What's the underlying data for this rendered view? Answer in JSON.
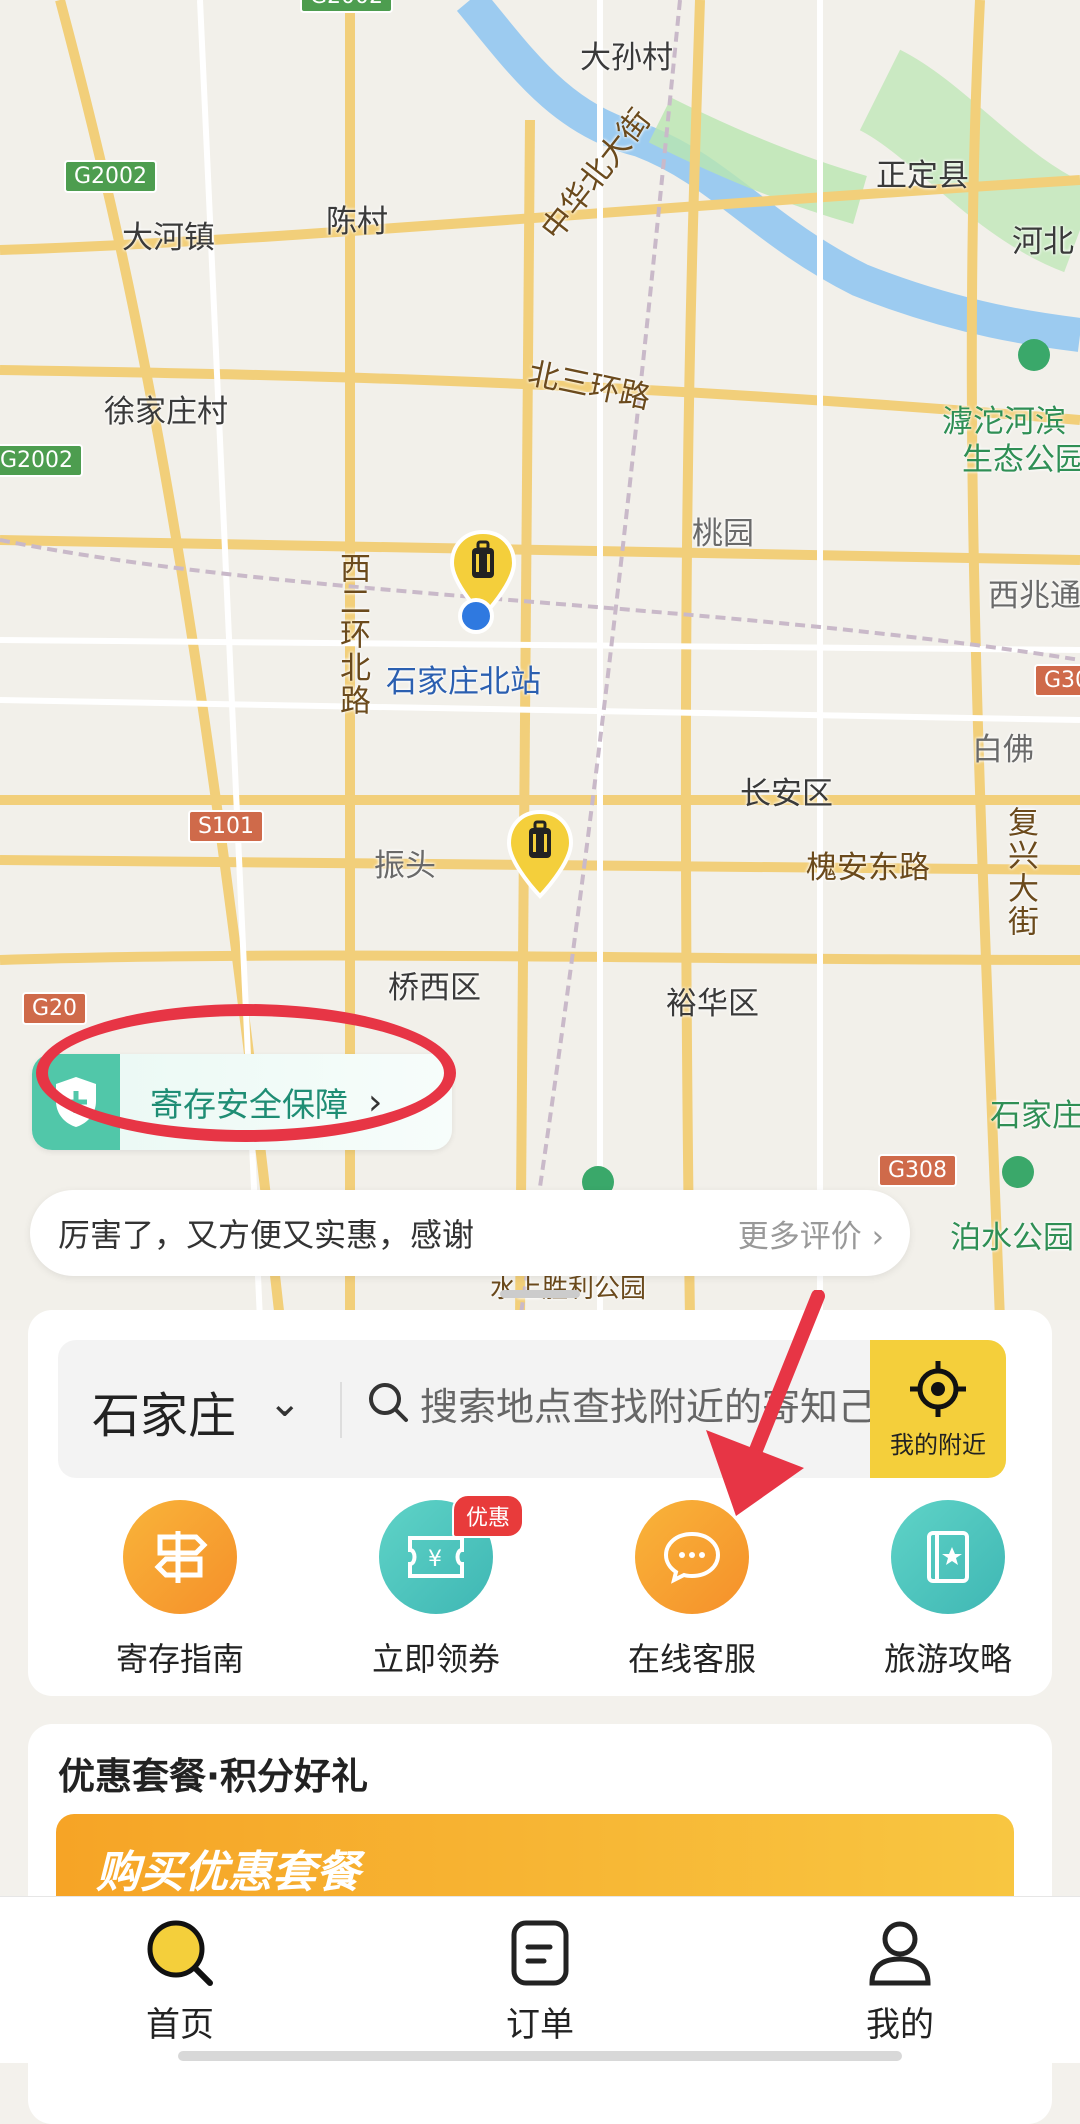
{
  "map": {
    "labels": {
      "dasun": "大孙村",
      "zhengding": "正定县",
      "hebei": "河北",
      "dahe": "大河镇",
      "chencun": "陈村",
      "zhonghua": "中华北大街",
      "beisanhuan": "北三环路",
      "xujiazhuang": "徐家庄村",
      "hutuo1": "滹沱河滨",
      "hutuo2": "生态公园",
      "taoyuan": "桃园",
      "xierhuan": "西二环北路",
      "xibei": "西兆通",
      "station": "石家庄北站",
      "baifo": "白佛",
      "changan": "长安区",
      "fuxing": "复兴大街",
      "zhentou": "振头",
      "huaian": "槐安东路",
      "qiaoxi": "桥西区",
      "yuhua": "裕华区",
      "shijia": "石家庄",
      "boshui": "泊水公园",
      "shengli": "水上胜利公园",
      "gongyuan_left": "公园"
    },
    "shields": {
      "g2002_a": "G2002",
      "g2002_b": "G2002",
      "g2002_c": "G2002",
      "s101": "S101",
      "g20": "G20",
      "g308": "G308",
      "g30": "G30"
    }
  },
  "safety_pill": {
    "label": "寄存安全保障"
  },
  "review": {
    "text": "厉害了，又方便又实惠，感谢",
    "more": "更多评价"
  },
  "search": {
    "city": "石家庄",
    "placeholder": "搜索地点查找附近的寄存点",
    "value": "搜索地点查找附近的寄知己",
    "nearby_label": "我的附近"
  },
  "shortcuts": [
    {
      "label": "寄存指南",
      "icon": "signpost-icon"
    },
    {
      "label": "立即领券",
      "icon": "coupon-icon",
      "badge": "优惠"
    },
    {
      "label": "在线客服",
      "icon": "chat-icon"
    },
    {
      "label": "旅游攻略",
      "icon": "guidebook-icon"
    }
  ],
  "promo": {
    "title": "优惠套餐·积分好礼",
    "banner_text": "购买优惠套餐"
  },
  "tabbar": [
    {
      "label": "首页",
      "icon": "home-search-icon",
      "active": true
    },
    {
      "label": "订单",
      "icon": "order-icon"
    },
    {
      "label": "我的",
      "icon": "profile-icon"
    }
  ],
  "colors": {
    "accent": "#f4cf3b",
    "teal": "#51c7a9",
    "orange": "#f6a426",
    "annotation_red": "#e73545"
  }
}
